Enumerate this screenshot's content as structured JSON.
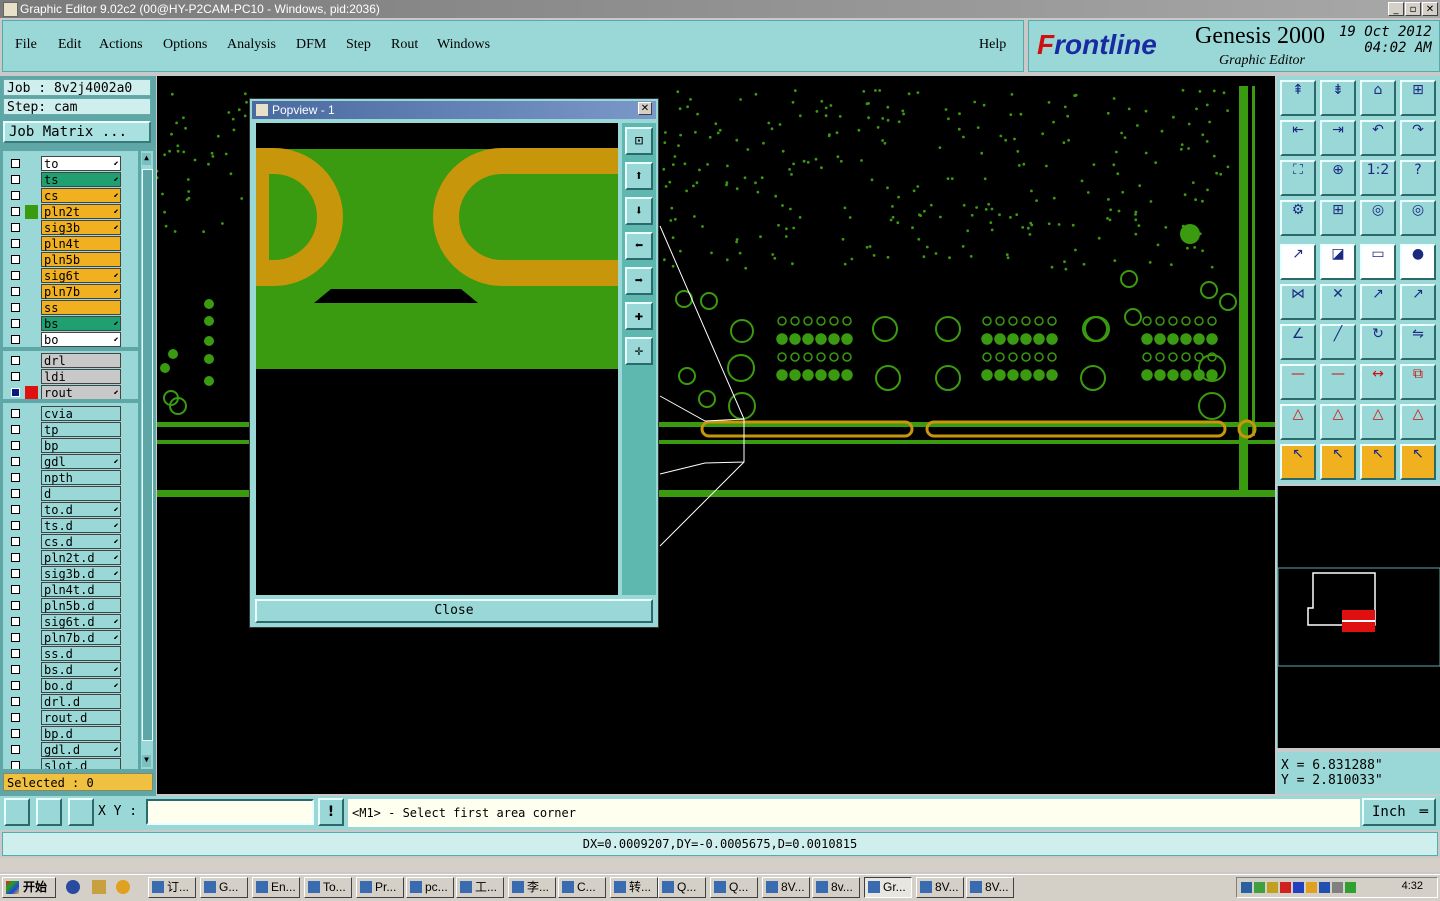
{
  "window": {
    "title": "Graphic Editor 9.02c2 (00@HY-P2CAM-PC10 - Windows, pid:2036)"
  },
  "menu": [
    "File",
    "Edit",
    "Actions",
    "Options",
    "Analysis",
    "DFM",
    "Step",
    "Rout",
    "Windows"
  ],
  "help": "Help",
  "brand": {
    "logo": "Frontline",
    "product": "Genesis 2000",
    "subtitle": "Graphic Editor",
    "date": "19 Oct 2012",
    "time": "04:02 AM"
  },
  "job": {
    "job_label": "Job : 8v2j4002a0",
    "step_label": "Step: cam",
    "matrix_button": "Job Matrix ..."
  },
  "layers_group1": [
    {
      "name": "to",
      "color": "#ffffff",
      "arrow": true
    },
    {
      "name": "ts",
      "color": "#20a070",
      "arrow": true
    },
    {
      "name": "cs",
      "color": "#f0b020",
      "arrow": true
    },
    {
      "name": "pln2t",
      "color": "#f0b020",
      "arrow": true
    },
    {
      "name": "sig3b",
      "color": "#f0b020",
      "arrow": true
    },
    {
      "name": "pln4t",
      "color": "#f0b020",
      "arrow": false
    },
    {
      "name": "pln5b",
      "color": "#f0b020",
      "arrow": false
    },
    {
      "name": "sig6t",
      "color": "#f0b020",
      "arrow": true
    },
    {
      "name": "pln7b",
      "color": "#f0b020",
      "arrow": true
    },
    {
      "name": "ss",
      "color": "#f0b020",
      "arrow": false
    },
    {
      "name": "bs",
      "color": "#20a070",
      "arrow": true
    },
    {
      "name": "bo",
      "color": "#ffffff",
      "arrow": true
    }
  ],
  "layers_group2": [
    {
      "name": "drl",
      "color": "#c8c8c8"
    },
    {
      "name": "ldi",
      "color": "#c8c8c8"
    },
    {
      "name": "rout",
      "color": "#c8c8c8"
    }
  ],
  "layers_group3": [
    "cvia",
    "tp",
    "bp",
    "gdl",
    "npth",
    "d",
    "to.d",
    "ts.d",
    "cs.d",
    "pln2t.d",
    "sig3b.d",
    "pln4t.d",
    "pln5b.d",
    "sig6t.d",
    "pln7b.d",
    "ss.d",
    "bs.d",
    "bo.d",
    "drl.d",
    "rout.d",
    "bp.d",
    "gdl.d",
    "slot.d"
  ],
  "selected": "Selected : 0",
  "popview": {
    "title": "Popview - 1",
    "close_label": "Close"
  },
  "coords": {
    "x": "X = 6.831288\"",
    "y": "Y = 2.810033\""
  },
  "cmd": {
    "xy_label": "X Y :",
    "xy_value": "",
    "prompt": "<M1> - Select first area corner",
    "units": "Inch"
  },
  "status": "DX=0.0009207,DY=-0.0005675,D=0.0010815",
  "taskbar": {
    "start": "开始",
    "tasks": [
      "订...",
      "G...",
      "En...",
      "To...",
      "Pr...",
      "pc...",
      "工...",
      "李...",
      "C...",
      "转...",
      "Q...",
      "Q...",
      "8V...",
      "8v...",
      "Gr...",
      "8V...",
      "8V..."
    ],
    "clock": "4:32"
  },
  "colors": {
    "board_green": "#3a9a10",
    "pad_gold": "#c8960a",
    "panel": "#9ad8d8",
    "canvas": "#000000"
  }
}
